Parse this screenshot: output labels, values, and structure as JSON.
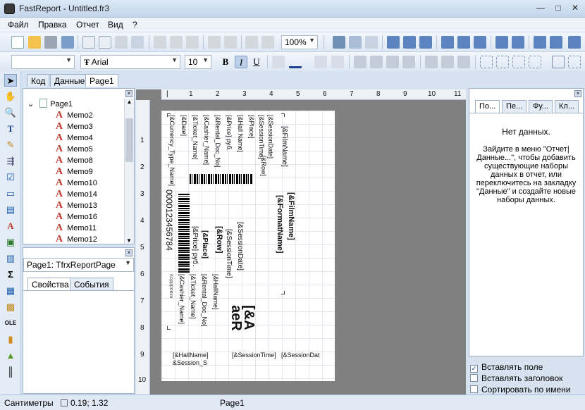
{
  "window": {
    "title": "FastReport - Untitled.fr3",
    "minimize": "—",
    "maximize": "□",
    "close": "✕"
  },
  "menu": [
    "Файл",
    "Правка",
    "Отчет",
    "Вид",
    "?"
  ],
  "toolbar": {
    "zoom": "100%",
    "font_name": "Arial",
    "font_size": "10",
    "font_name_glyph": "Ŧ",
    "bold": "B",
    "italic": "I",
    "underline": "U"
  },
  "tabs": [
    "Код",
    "Данные",
    "Page1"
  ],
  "tree": {
    "root": "Page1",
    "items": [
      "Memo2",
      "Memo3",
      "Memo4",
      "Memo5",
      "Memo8",
      "Memo9",
      "Memo10",
      "Memo14",
      "Memo13",
      "Memo16",
      "Memo11",
      "Memo12"
    ]
  },
  "object_selector": "Page1: TfrxReportPage",
  "inspector_tabs": [
    "Свойства",
    "События"
  ],
  "ruler": {
    "h": [
      "1",
      "2",
      "3",
      "4",
      "5",
      "6",
      "7",
      "8",
      "9",
      "10",
      "11"
    ],
    "v": [
      "1",
      "2",
      "3",
      "4",
      "5",
      "6",
      "7",
      "8",
      "9",
      "10"
    ]
  },
  "right_tabs": [
    "По...",
    "Пе...",
    "Фу...",
    "Кл..."
  ],
  "data_panel": {
    "no_data": "Нет данных.",
    "hint": "Зайдите в меню \"Отчет|Данные...\", чтобы добавить существующие наборы данных в отчет, или переключитесь на закладку \"Данные\" и создайте новые наборы данных."
  },
  "options": [
    {
      "label": "Вставлять поле",
      "checked": true
    },
    {
      "label": "Вставлять заголовок",
      "checked": false
    },
    {
      "label": "Сортировать по имени",
      "checked": false
    }
  ],
  "status": {
    "units": "Сантиметры",
    "coords": "0.19; 1.32",
    "page": "Page1"
  },
  "report": {
    "top_fields": [
      "[&Currency_Type_Name]",
      "[&Date]",
      "[&Ticket_Name]",
      "[&Cashier_Name]",
      "[&Rental_Doc_No]",
      "[&Price] руб.",
      "[&Hall Name]",
      "[&Place]",
      "[&SessionTime]",
      "[&SessionDate]",
      "[&Row]",
      "[&FilmName]"
    ],
    "barcode_number": "0000123456784",
    "mid_fields": [
      "[&Place]",
      "[&Price] руб.",
      "[&Row]",
      "[&SessionTime]",
      "[&SessionDate]"
    ],
    "film_name": "[&FilmName]",
    "format_name": "[&FormatName]",
    "lower_fields": [
      "Кодировка",
      "[&Cashier_Name]",
      "[&Ticket_Name]",
      "[&Rental_Doc_No]",
      "[&HallName]"
    ],
    "big_text_1": "[&A",
    "big_text_2": "aeR",
    "bottom_fields": [
      "[&HallName]",
      "&Session_S",
      "[&SessionTime]",
      "[&SessionDat"
    ]
  }
}
